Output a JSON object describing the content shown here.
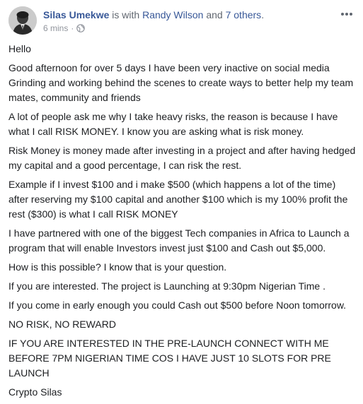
{
  "post": {
    "author": "Silas Umekwe",
    "with_text": "is with",
    "tagged_person": "Randy Wilson",
    "and_text": "and",
    "tagged_others": "7 others",
    "period": ".",
    "timestamp": "6 mins",
    "separator": "·",
    "privacy_icon": "globe-icon",
    "more_icon": "more-horizontal-icon",
    "avatar_icon": "profile-photo"
  },
  "body": {
    "paragraphs": [
      "Hello",
      "Good afternoon for over 5 days I have been very inactive on social media Grinding and working behind the scenes to create ways to better help my team mates, community and friends",
      "A lot of people ask me why I take heavy risks, the reason is because I have what I call RISK MONEY. I know you are asking what is risk money.",
      "Risk Money is money made after investing in a project and after having hedged my capital and a good percentage, I can risk the rest.",
      "Example if I invest $100 and i make $500 (which happens a lot of the time) after reserving my $100 capital and another $100 which is my 100% profit the rest ($300) is what I call RISK MONEY",
      "I have partnered with one of the biggest Tech companies in Africa to Launch a program that will enable Investors invest just $100 and Cash out $5,000.",
      "How is this possible? I know that is your question.",
      "If you are interested. The project is Launching at 9:30pm Nigerian Time .",
      "If you come in early enough you could Cash out $500 before Noon tomorrow.",
      "NO RISK, NO REWARD",
      "IF YOU ARE INTERESTED IN THE PRE-LAUNCH CONNECT WITH ME BEFORE 7PM NIGERIAN TIME COS I HAVE JUST 10 SLOTS FOR PRE LAUNCH",
      "Crypto Silas"
    ]
  },
  "colors": {
    "link": "#385898",
    "text": "#1c1e21",
    "meta": "#90949c"
  }
}
